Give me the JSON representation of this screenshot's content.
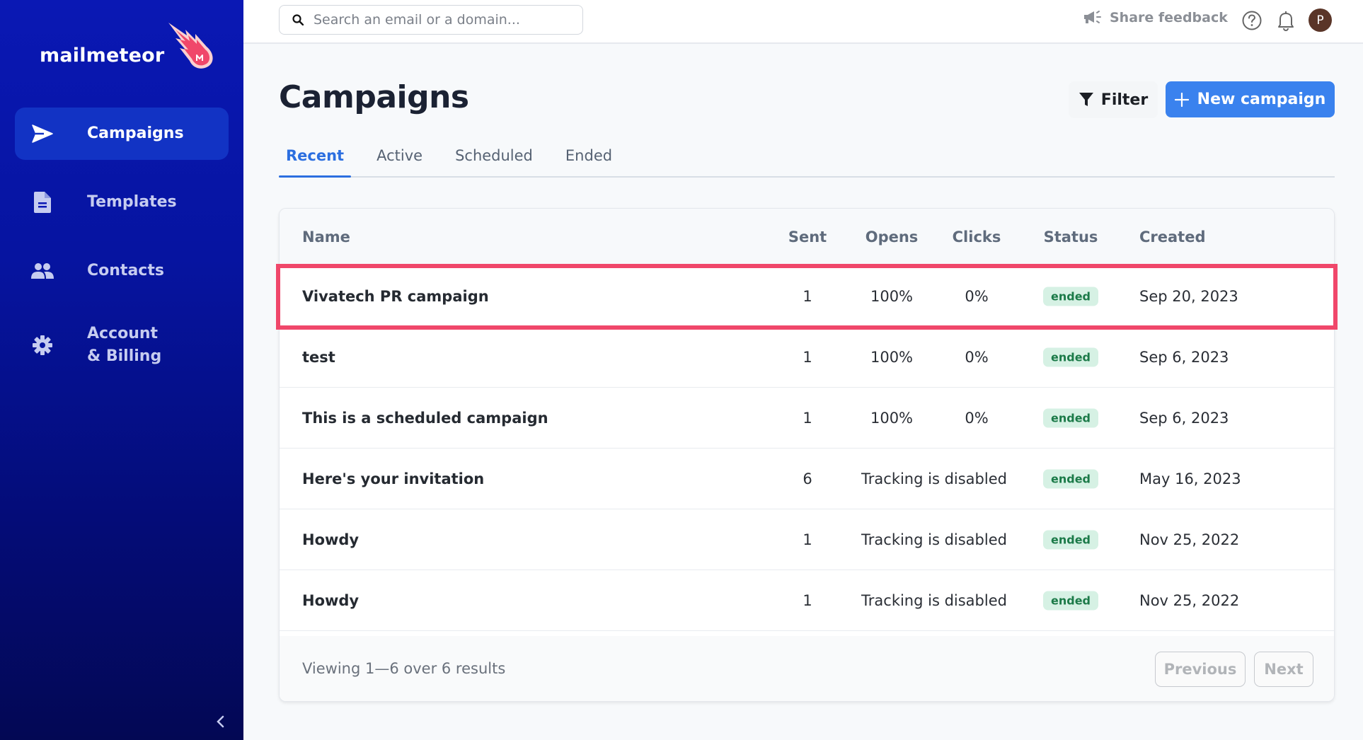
{
  "brand": {
    "name": "mailmeteor",
    "accent": "#3a82ee",
    "highlight": "#f0476a"
  },
  "sidebar": {
    "items": [
      {
        "label": "Campaigns",
        "icon": "send-icon",
        "active": true
      },
      {
        "label": "Templates",
        "icon": "document-icon",
        "active": false
      },
      {
        "label": "Contacts",
        "icon": "users-icon",
        "active": false
      },
      {
        "label": "Account\n& Billing",
        "label_line1": "Account",
        "label_line2": "& Billing",
        "icon": "gear-icon",
        "active": false
      }
    ],
    "collapse_icon": "chevron-left-icon"
  },
  "topbar": {
    "search": {
      "placeholder": "Search an email or a domain...",
      "value": ""
    },
    "feedback_label": "Share feedback",
    "avatar_initial": "P"
  },
  "page": {
    "title": "Campaigns",
    "filter_label": "Filter",
    "new_campaign_label": "New campaign",
    "tabs": [
      {
        "label": "Recent",
        "active": true
      },
      {
        "label": "Active",
        "active": false
      },
      {
        "label": "Scheduled",
        "active": false
      },
      {
        "label": "Ended",
        "active": false
      }
    ]
  },
  "table": {
    "columns": [
      "Name",
      "Sent",
      "Opens",
      "Clicks",
      "Status",
      "Created"
    ],
    "rows": [
      {
        "name": "Vivatech PR campaign",
        "sent": "1",
        "opens": "100%",
        "clicks": "0%",
        "tracking": "",
        "status": "ended",
        "created": "Sep 20, 2023",
        "highlighted": true
      },
      {
        "name": "test",
        "sent": "1",
        "opens": "100%",
        "clicks": "0%",
        "tracking": "",
        "status": "ended",
        "created": "Sep 6, 2023"
      },
      {
        "name": "This is a scheduled campaign",
        "sent": "1",
        "opens": "100%",
        "clicks": "0%",
        "tracking": "",
        "status": "ended",
        "created": "Sep 6, 2023"
      },
      {
        "name": "Here's your invitation",
        "sent": "6",
        "opens": "",
        "clicks": "",
        "tracking": "Tracking is disabled",
        "status": "ended",
        "created": "May 16, 2023"
      },
      {
        "name": "Howdy",
        "sent": "1",
        "opens": "",
        "clicks": "",
        "tracking": "Tracking is disabled",
        "status": "ended",
        "created": "Nov 25, 2022"
      },
      {
        "name": "Howdy",
        "sent": "1",
        "opens": "",
        "clicks": "",
        "tracking": "Tracking is disabled",
        "status": "ended",
        "created": "Nov 25, 2022"
      }
    ],
    "footer": {
      "viewing": "Viewing 1—6 over 6 results",
      "previous_label": "Previous",
      "next_label": "Next"
    }
  }
}
